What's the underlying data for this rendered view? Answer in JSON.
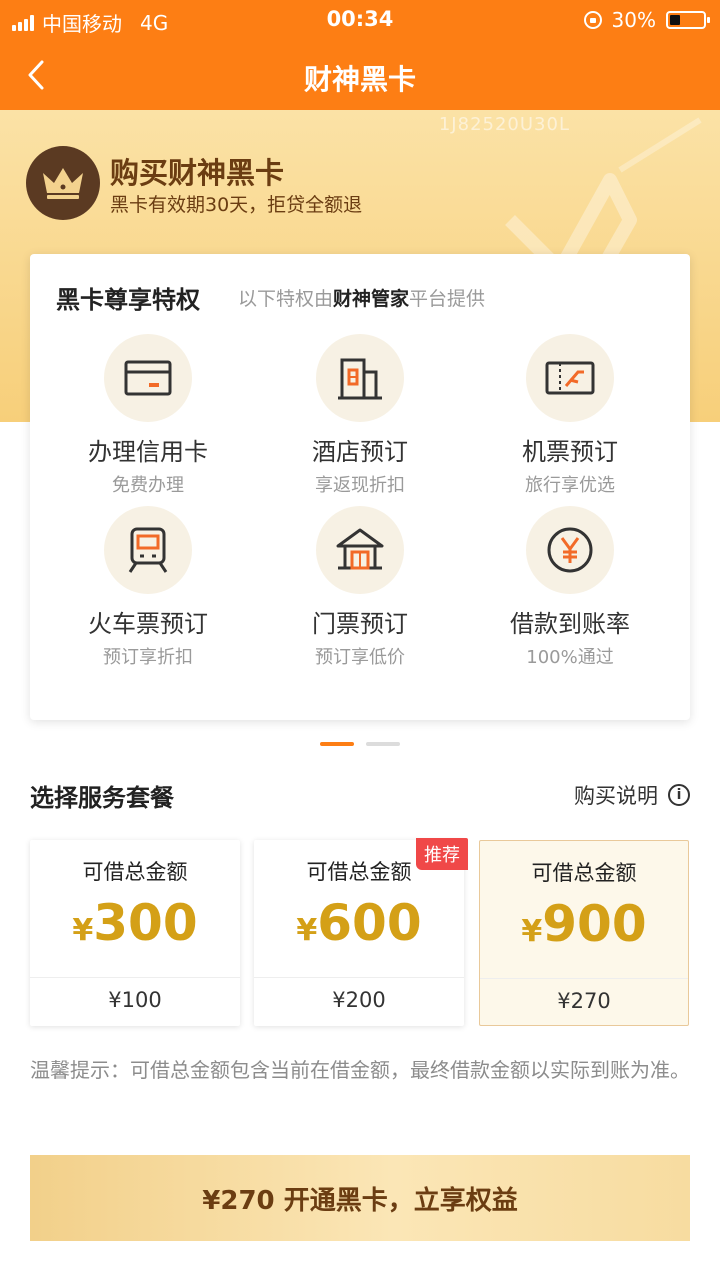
{
  "status_bar": {
    "carrier": "中国移动",
    "network": "4G",
    "time": "00:34",
    "battery": "30%"
  },
  "navbar": {
    "title": "财神黑卡"
  },
  "hero": {
    "serial": "1J82520U30L",
    "title": "购买财神黑卡",
    "subtitle": "黑卡有效期30天，拒贷全额退"
  },
  "privileges": {
    "title": "黑卡尊享特权",
    "note_prefix": "以下特权由",
    "note_brand": "财神管家",
    "note_suffix": "平台提供",
    "items": [
      {
        "name": "办理信用卡",
        "desc": "免费办理",
        "icon": "credit-card-icon"
      },
      {
        "name": "酒店预订",
        "desc": "享返现折扣",
        "icon": "hotel-icon"
      },
      {
        "name": "机票预订",
        "desc": "旅行享优选",
        "icon": "flight-ticket-icon"
      },
      {
        "name": "火车票预订",
        "desc": "预订享折扣",
        "icon": "train-icon"
      },
      {
        "name": "门票预订",
        "desc": "预订享低价",
        "icon": "attraction-ticket-icon"
      },
      {
        "name": "借款到账率",
        "desc": "100%通过",
        "icon": "yen-icon"
      }
    ]
  },
  "pager": {
    "count": 2,
    "active": 0
  },
  "packages": {
    "title": "选择服务套餐",
    "info_link": "购买说明",
    "plans": [
      {
        "label": "可借总金额",
        "currency": "¥",
        "amount": "300",
        "fee": "¥100",
        "badge": "",
        "selected": false
      },
      {
        "label": "可借总金额",
        "currency": "¥",
        "amount": "600",
        "fee": "¥200",
        "badge": "推荐",
        "selected": false
      },
      {
        "label": "可借总金额",
        "currency": "¥",
        "amount": "900",
        "fee": "¥270",
        "badge": "",
        "selected": true
      }
    ]
  },
  "tip": "温馨提示：可借总金额包含当前在借金额，最终借款金额以实际到账为准。",
  "cta": {
    "label": "¥270 开通黑卡，立享权益"
  },
  "colors": {
    "brand_orange": "#fd7e14",
    "gold": "#d4a017",
    "badge_red": "#f04848"
  }
}
